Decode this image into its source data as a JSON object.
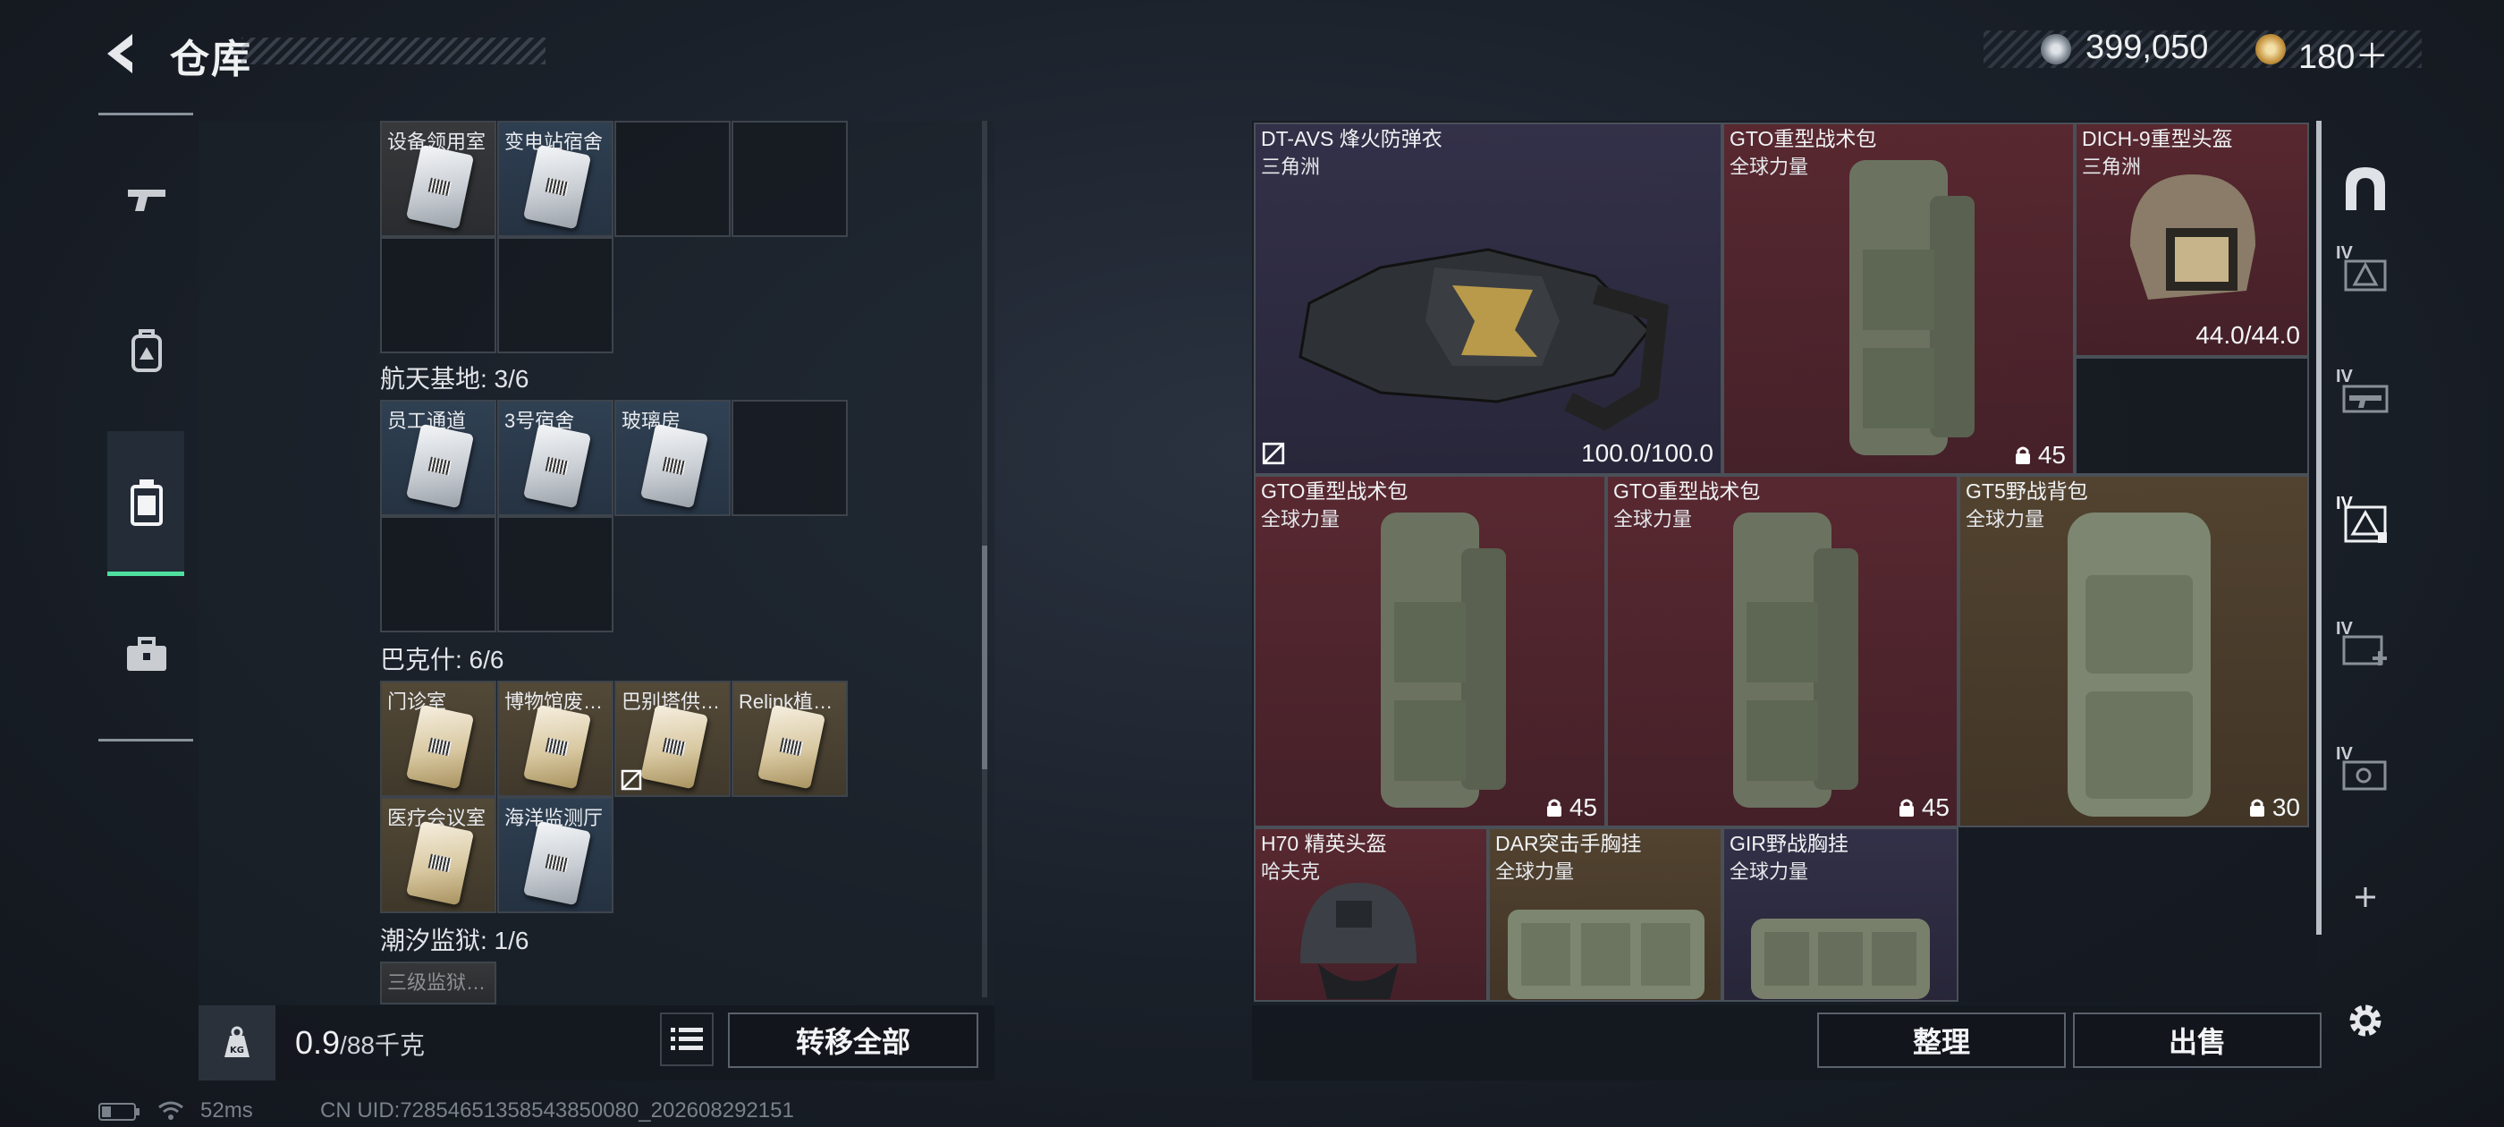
{
  "header": {
    "title": "仓库",
    "currency": [
      {
        "icon": "coin-icon",
        "value": "399,050",
        "color": "#b8c0c8"
      },
      {
        "icon": "premium-coin-icon",
        "value": "180＋",
        "color": "#d8b060"
      }
    ]
  },
  "left_nav": [
    {
      "name": "weapons",
      "icon": "gun-icon",
      "active": false
    },
    {
      "name": "equipment",
      "icon": "backpack-icon",
      "active": false
    },
    {
      "name": "keys",
      "icon": "keycard-case-icon",
      "active": true
    },
    {
      "name": "items",
      "icon": "toolbox-icon",
      "active": false
    }
  ],
  "key_sections": [
    {
      "title": "",
      "cells": [
        "设备领用室",
        "变电站宿舍",
        "",
        "",
        "",
        ""
      ]
    },
    {
      "title": "航天基地: 3/6",
      "cells": [
        "员工通道",
        "3号宿舍",
        "玻璃房",
        "",
        "",
        ""
      ]
    },
    {
      "title": "巴克什: 6/6",
      "cells": [
        "门诊室",
        "博物馆废…",
        "巴别塔供…",
        "Relink植…",
        "医疗会议室",
        "海洋监测厅"
      ]
    },
    {
      "title": "潮汐监狱: 1/6",
      "cells": [
        "三级监狱…"
      ]
    }
  ],
  "capacity": {
    "current": "0.9",
    "max": "/88千克"
  },
  "buttons": {
    "transfer_all": "转移全部",
    "sort": "整理",
    "sell": "出售"
  },
  "items": [
    {
      "name": "DT-AVS 烽火防弹衣",
      "sub": "三角洲",
      "value": "100.0/100.0",
      "rarity": "purple",
      "non_tradable": true
    },
    {
      "name": "GTO重型战术包",
      "sub": "全球力量",
      "capacity": "45",
      "rarity": "red"
    },
    {
      "name": "DICH-9重型头盔",
      "sub": "三角洲",
      "value": "44.0/44.0",
      "rarity": "red"
    },
    {
      "name": "GTO重型战术包",
      "sub": "全球力量",
      "capacity": "45",
      "rarity": "red"
    },
    {
      "name": "GTO重型战术包",
      "sub": "全球力量",
      "capacity": "45",
      "rarity": "red"
    },
    {
      "name": "GT5野战背包",
      "sub": "全球力量",
      "capacity": "30",
      "rarity": "gold"
    },
    {
      "name": "H70 精英头盔",
      "sub": "哈夫克",
      "rarity": "red"
    },
    {
      "name": "DAR突击手胸挂",
      "sub": "全球力量",
      "rarity": "gold"
    },
    {
      "name": "GIR野战胸挂",
      "sub": "全球力量",
      "rarity": "purple"
    }
  ],
  "right_tabs": [
    {
      "icon": "arch-icon",
      "level": ""
    },
    {
      "icon": "armor-rack-icon",
      "level": "IV"
    },
    {
      "icon": "weapon-rack-icon",
      "level": "IV"
    },
    {
      "icon": "gear-box-icon",
      "level": "IV"
    },
    {
      "icon": "medical-box-icon",
      "level": "IV"
    },
    {
      "icon": "key-box-icon",
      "level": "IV"
    }
  ],
  "status": {
    "ping": "52ms",
    "uid": "CN UID:7285465135854385008​0_202608292151"
  }
}
